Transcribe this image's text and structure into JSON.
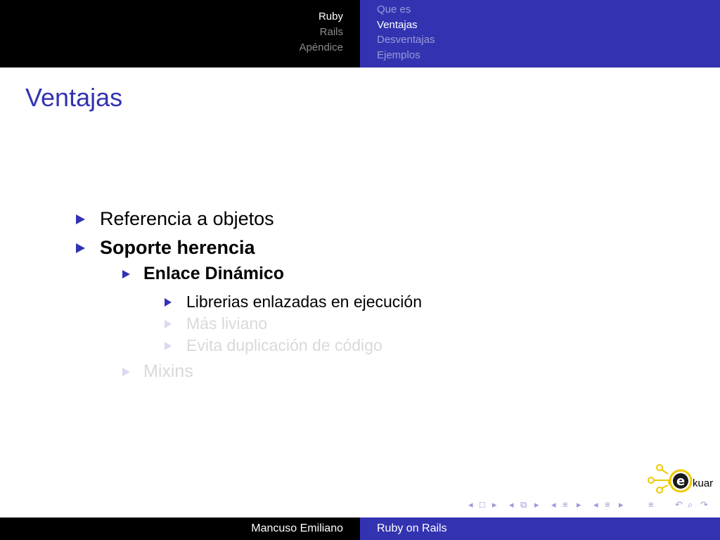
{
  "header": {
    "sections": [
      "Ruby",
      "Rails",
      "Apéndice"
    ],
    "active_section": 0,
    "subsections": [
      "Que es",
      "Ventajas",
      "Desventajas",
      "Ejemplos"
    ],
    "active_subsection": 1
  },
  "slide": {
    "title": "Ventajas",
    "items": [
      {
        "text": "Referencia a objetos",
        "level": 1,
        "bold": false,
        "faded": false
      },
      {
        "text": "Soporte herencia",
        "level": 1,
        "bold": true,
        "faded": false
      },
      {
        "text": "Enlace Dinámico",
        "level": 2,
        "bold": true,
        "faded": false
      },
      {
        "text": "Librerias enlazadas en ejecución",
        "level": 3,
        "bold": false,
        "faded": false
      },
      {
        "text": "Más liviano",
        "level": 3,
        "bold": false,
        "faded": true
      },
      {
        "text": "Evita duplicación de código",
        "level": 3,
        "bold": false,
        "faded": true
      },
      {
        "text": "Mixins",
        "level": 2,
        "bold": false,
        "faded": true
      }
    ]
  },
  "logo": {
    "text": "kuar",
    "letter": "e"
  },
  "footer": {
    "author": "Mancuso Emiliano",
    "presentation_title": "Ruby on Rails"
  },
  "colors": {
    "accent": "#3333b2",
    "header_left_bg": "#000000",
    "faded_text": "#d9d9d9"
  },
  "icons": {
    "nav": [
      "nav-frame-prev-icon",
      "nav-frame-icon",
      "nav-frame-next-icon",
      "nav-subsection-prev-icon",
      "nav-subsection-icon",
      "nav-subsection-next-icon",
      "nav-section-prev-icon",
      "nav-section-icon",
      "nav-section-next-icon",
      "nav-presentation-prev-icon",
      "nav-presentation-icon",
      "nav-presentation-next-icon",
      "nav-toc-icon",
      "nav-search-back-icon",
      "nav-search-icon",
      "nav-search-forward-icon"
    ]
  }
}
